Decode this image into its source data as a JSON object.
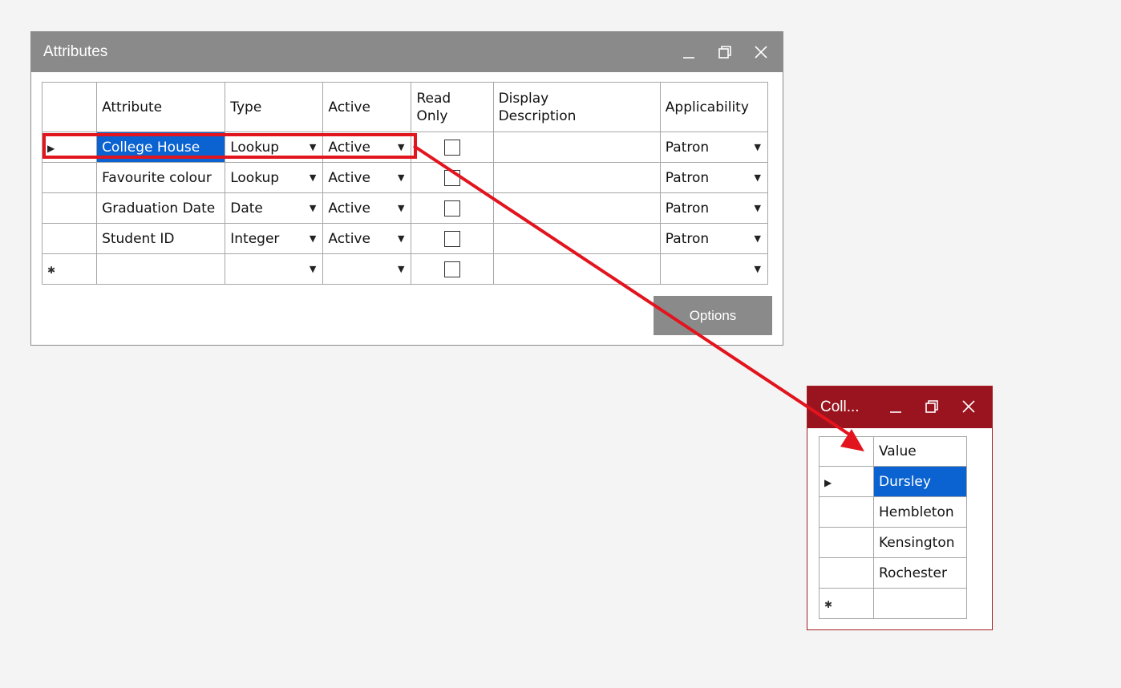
{
  "attributes_window": {
    "title": "Attributes",
    "columns": [
      "Attribute",
      "Type",
      "Active",
      "Read\nOnly",
      "Display\nDescription",
      "Applicability"
    ],
    "rows": [
      {
        "attribute": "College House",
        "type": "Lookup",
        "active": "Active",
        "display_description": "",
        "applicability": "Patron"
      },
      {
        "attribute": "Favourite colour",
        "type": "Lookup",
        "active": "Active",
        "display_description": "",
        "applicability": "Patron"
      },
      {
        "attribute": "Graduation Date",
        "type": "Date",
        "active": "Active",
        "display_description": "",
        "applicability": "Patron"
      },
      {
        "attribute": "Student ID",
        "type": "Integer",
        "active": "Active",
        "display_description": "",
        "applicability": "Patron"
      }
    ],
    "options_label": "Options"
  },
  "lookup_window": {
    "title": "Coll...",
    "column": "Value",
    "values": [
      "Dursley",
      "Hembleton",
      "Kensington",
      "Rochester"
    ]
  },
  "colors": {
    "titlebar": "#8a8a8a",
    "lookup_titlebar": "#99141f",
    "selection": "#0a63d1",
    "highlight": "#e2141e"
  },
  "icons": {
    "minimize": "minimize-icon",
    "restore": "restore-icon",
    "close": "close-icon",
    "row_pointer": "row-pointer-icon",
    "new_row": "new-row-icon",
    "dropdown": "dropdown-arrow-icon"
  }
}
